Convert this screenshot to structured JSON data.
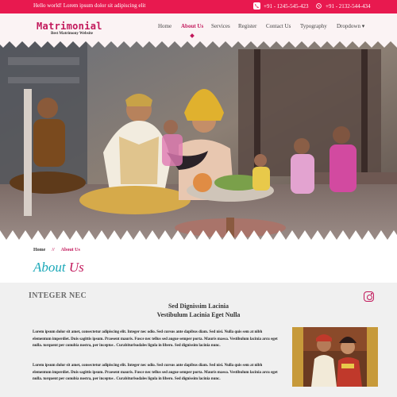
{
  "topbar": {
    "message": "Hello world! Lorem ipsum dolor sit adipiscing elit",
    "phone": "+91 - 1245-545-423",
    "whatsapp": "+91 - 2132-544-434"
  },
  "brand": {
    "logo": "Matrimonial",
    "tagline": "Best Matrimony Website"
  },
  "nav": {
    "items": [
      {
        "label": "Home"
      },
      {
        "label": "About Us"
      },
      {
        "label": "Services"
      },
      {
        "label": "Register"
      },
      {
        "label": "Contact Us"
      },
      {
        "label": "Typography"
      },
      {
        "label": "Dropdown ▾"
      }
    ],
    "active_index": 1
  },
  "breadcrumb": {
    "home": "Home",
    "separator": "//",
    "current": "About Us"
  },
  "page_title": {
    "part1": "About",
    "part2": "Us"
  },
  "section": {
    "heading": "INTEGER NEC",
    "subtitle1": "Sed Dignissim Lacinia",
    "subtitle2": "Vestibulum Lacinia Eget Nulla",
    "paragraph1": "Lorem ipsum dolor sit amet, consectetur adipiscing elit. Integer nec odio. Sed cursus ante dapibus diam. Sed nisi. Nulla quis sem at nibh elementum imperdiet. Duis sagittis ipsum. Praesent mauris. Fusce nec tellus sed augue semper porta. Mauris massa. Vestibulum lacinia arcu eget nulla. torquent per conubia nostra, per inceptos . Curabiturlsodales ligula in libero. Sed dignissim lacinia nunc.",
    "paragraph2": "Lorem ipsum dolor sit amet, consectetur adipiscing elit. Integer nec odio. Sed cursus ante dapibus diam. Sed nisi. Nulla quis sem at nibh elementum imperdiet. Duis sagittis ipsum. Praesent mauris. Fusce nec tellus sed augue semper porta. Mauris massa. Vestibulum lacinia arcu eget nulla. torquent per conubia nostra, per inceptos . Curabiturlsodales ligula in libero. Sed dignissim lacinia nunc."
  },
  "colors": {
    "accent": "#e8194f",
    "brand": "#c2185b",
    "title_teal": "#1aa8b8"
  },
  "icons": {
    "phone": "phone-icon",
    "whatsapp": "whatsapp-icon",
    "instagram": "instagram-icon"
  }
}
